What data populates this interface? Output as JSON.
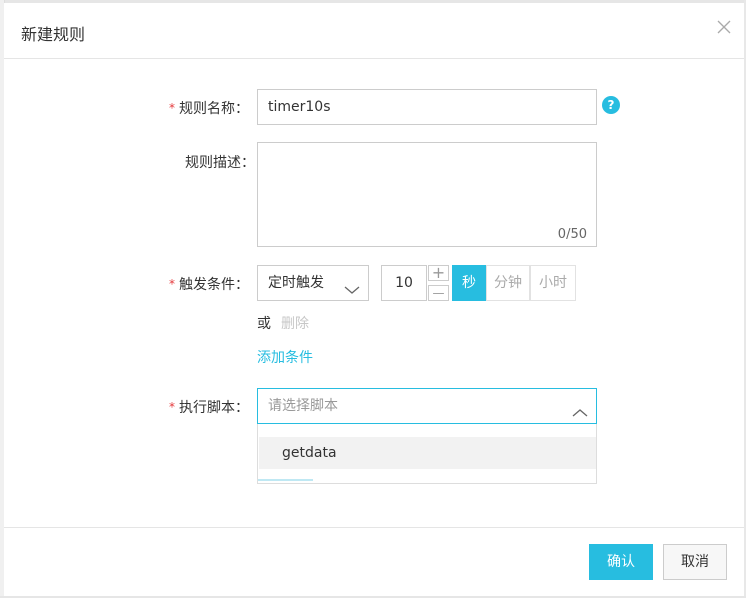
{
  "dialog": {
    "title": "新建规则",
    "close_icon": "close-icon"
  },
  "form": {
    "name": {
      "required_mark": "*",
      "label": "规则名称：",
      "value": "timer10s",
      "help": "?"
    },
    "description": {
      "label": "规则描述：",
      "value": "",
      "counter": "0/50"
    },
    "trigger": {
      "required_mark": "*",
      "label": "触发条件：",
      "type_value": "定时触发",
      "interval_value": "10",
      "increment": "+",
      "decrement": "—",
      "units": [
        "秒",
        "分钟",
        "小时"
      ],
      "active_unit": "秒",
      "or_text": "或",
      "delete_text": "删除",
      "add_condition": "添加条件"
    },
    "script": {
      "required_mark": "*",
      "label": "执行脚本：",
      "placeholder": "请选择脚本",
      "options": [
        "getdata"
      ]
    }
  },
  "footer": {
    "confirm": "确认",
    "cancel": "取消"
  },
  "colors": {
    "accent": "#27bde0",
    "required": "#e4393c",
    "disabled": "#c7c7c7"
  }
}
